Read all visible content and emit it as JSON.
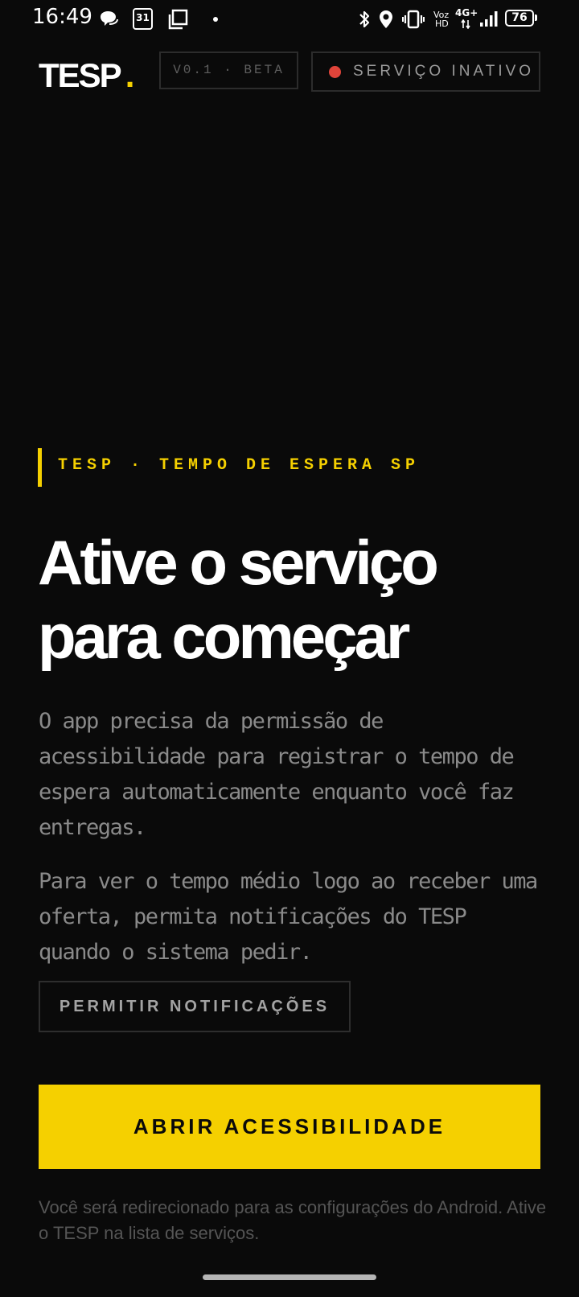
{
  "status_bar": {
    "time": "16:49",
    "calendar_day": "31",
    "volte_top": "Voz",
    "volte_bottom": "HD",
    "network": "4G+",
    "battery": "76",
    "icons": [
      "chat-bubble-icon",
      "calendar-icon",
      "copy-icon",
      "dot-icon",
      "bluetooth-icon",
      "location-icon",
      "vibrate-icon",
      "signal-icon"
    ]
  },
  "header": {
    "brand": "TESP",
    "brand_dot": ".",
    "version": "V0.1 · BETA",
    "service_status": "SERVIÇO INATIVO",
    "status_color": "#e0443a"
  },
  "hero": {
    "eyebrow": "TESP · TEMPO DE ESPERA SP",
    "headline_line1": "Ative o serviço",
    "headline_line2": "para começar",
    "body_1": "O app precisa da permissão de acessibilidade para registrar o tempo de espera automaticamente enquanto você faz entregas.",
    "body_2": "Para ver o tempo médio logo ao receber uma oferta, permita notificações do TESP quando o sistema pedir."
  },
  "actions": {
    "notifications_button": "PERMITIR NOTIFICAÇÕES",
    "primary_button": "ABRIR ACESSIBILIDADE",
    "footer_note": "Você será redirecionado para as configurações do Android. Ative o TESP na lista de serviços."
  },
  "colors": {
    "background": "#0a0a0a",
    "accent": "#f5d000",
    "muted_text": "#8a8a8a"
  }
}
